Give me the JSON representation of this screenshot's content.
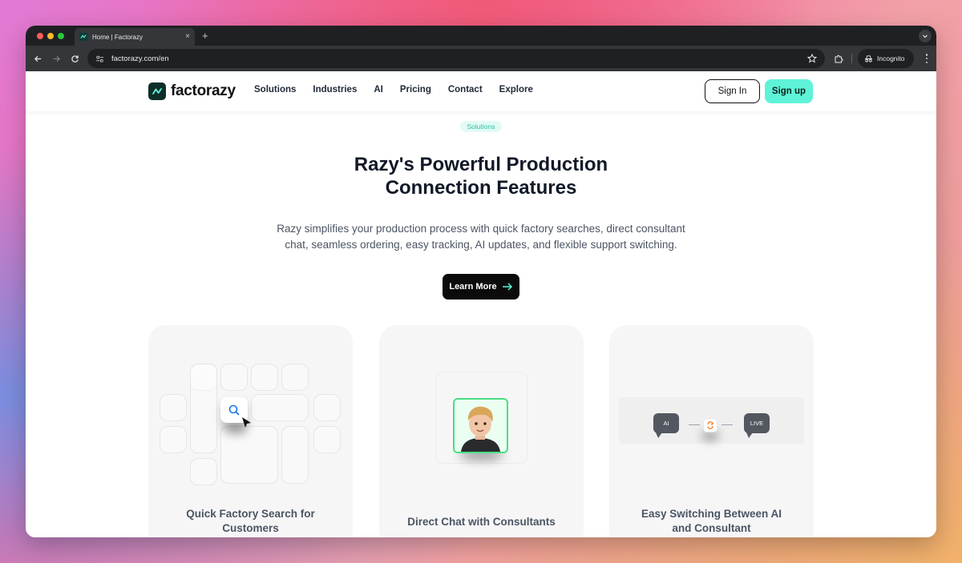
{
  "browser": {
    "tab_title": "Home | Factorazy",
    "tab_close": "×",
    "new_tab": "+",
    "url": "factorazy.com/en",
    "incognito_label": "Incognito"
  },
  "header": {
    "logo_text": "factorazy",
    "nav": [
      "Solutions",
      "Industries",
      "AI",
      "Pricing",
      "Contact",
      "Explore"
    ],
    "sign_in": "Sign In",
    "sign_up": "Sign up"
  },
  "hero": {
    "badge": "Solutions",
    "title_line1": "Razy's Powerful Production",
    "title_line2": "Connection Features",
    "desc_line1": "Razy simplifies your production process with quick factory searches, direct consultant",
    "desc_line2": "chat, seamless ordering, easy tracking, AI updates, and flexible support switching.",
    "cta": "Learn More"
  },
  "cards": [
    {
      "title_line1": "Quick Factory Search for",
      "title_line2": "Customers"
    },
    {
      "title_line1": "Direct Chat with Consultants",
      "title_line2": ""
    },
    {
      "title_line1": "Easy Switching Between AI",
      "title_line2": "and Consultant",
      "bubble_left": "AI",
      "bubble_right": "LIVE"
    }
  ],
  "colors": {
    "accent": "#5ef3d8",
    "badge_text": "#2bbfa3",
    "avatar_border": "#4ade80",
    "search_icon": "#1a73e8",
    "switch_icon": "#f97316"
  }
}
